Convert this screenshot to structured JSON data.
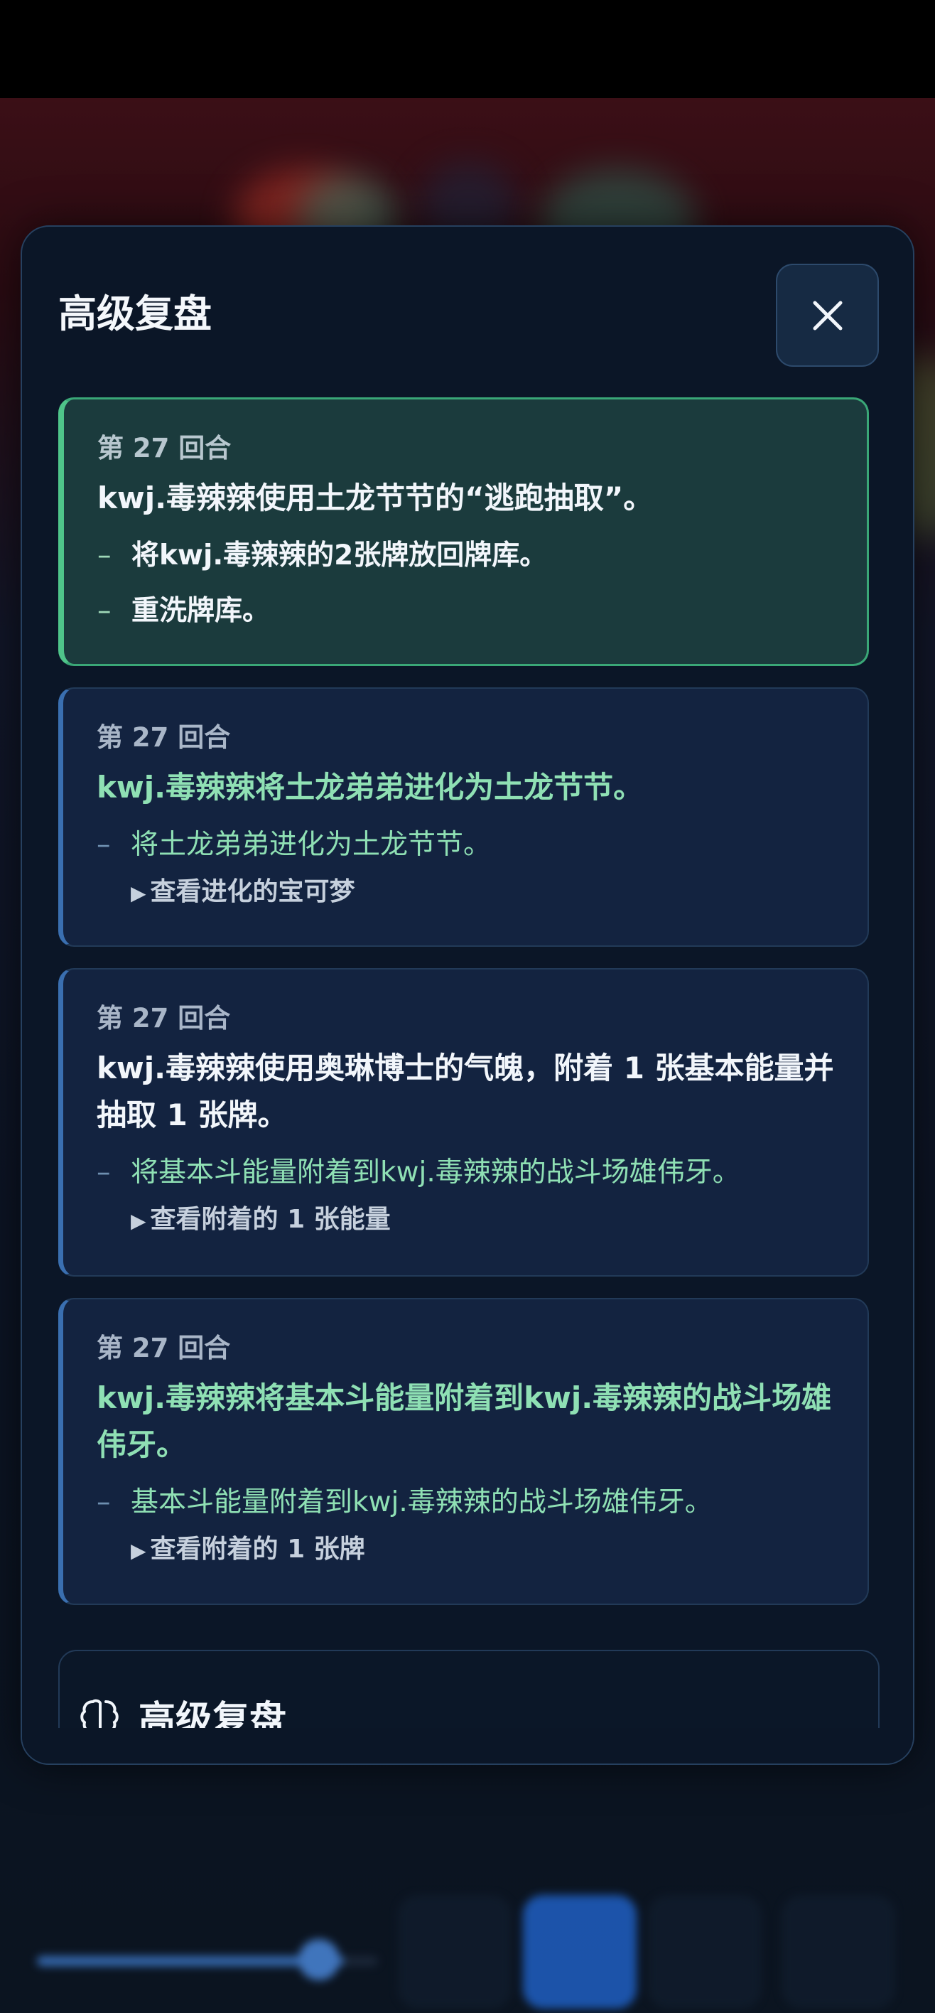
{
  "modal": {
    "title": "高级复盘",
    "close_icon": "close-icon",
    "entries": [
      {
        "turn": "第 27 回合",
        "title": "kwj.毒辣辣使用土龙节节的“逃跑抽取”。",
        "details": [
          "将kwj.毒辣辣的2张牌放回牌库。",
          "重洗牌库。"
        ]
      },
      {
        "turn": "第 27 回合",
        "title": "kwj.毒辣辣将土龙弟弟进化为土龙节节。",
        "details": [
          "将土龙弟弟进化为土龙节节。"
        ],
        "toggle": "查看进化的宝可梦"
      },
      {
        "turn": "第 27 回合",
        "title": "kwj.毒辣辣使用奥琳博士的气魄，附着 1 张基本能量并抽取 1 张牌。",
        "details": [
          "将基本斗能量附着到kwj.毒辣辣的战斗场雄伟牙。"
        ],
        "toggle": "查看附着的 1 张能量"
      },
      {
        "turn": "第 27 回合",
        "title": "kwj.毒辣辣将基本斗能量附着到kwj.毒辣辣的战斗场雄伟牙。",
        "details": [
          "基本斗能量附着到kwj.毒辣辣的战斗场雄伟牙。"
        ],
        "toggle": "查看附着的 1 张牌"
      }
    ],
    "section_heading": "高级复盘",
    "section_icon": "brain-icon"
  },
  "colors": {
    "accent_green": "#4fc58a",
    "accent_blue": "#3a6fb0",
    "action_text_green": "#8fe0b4"
  }
}
